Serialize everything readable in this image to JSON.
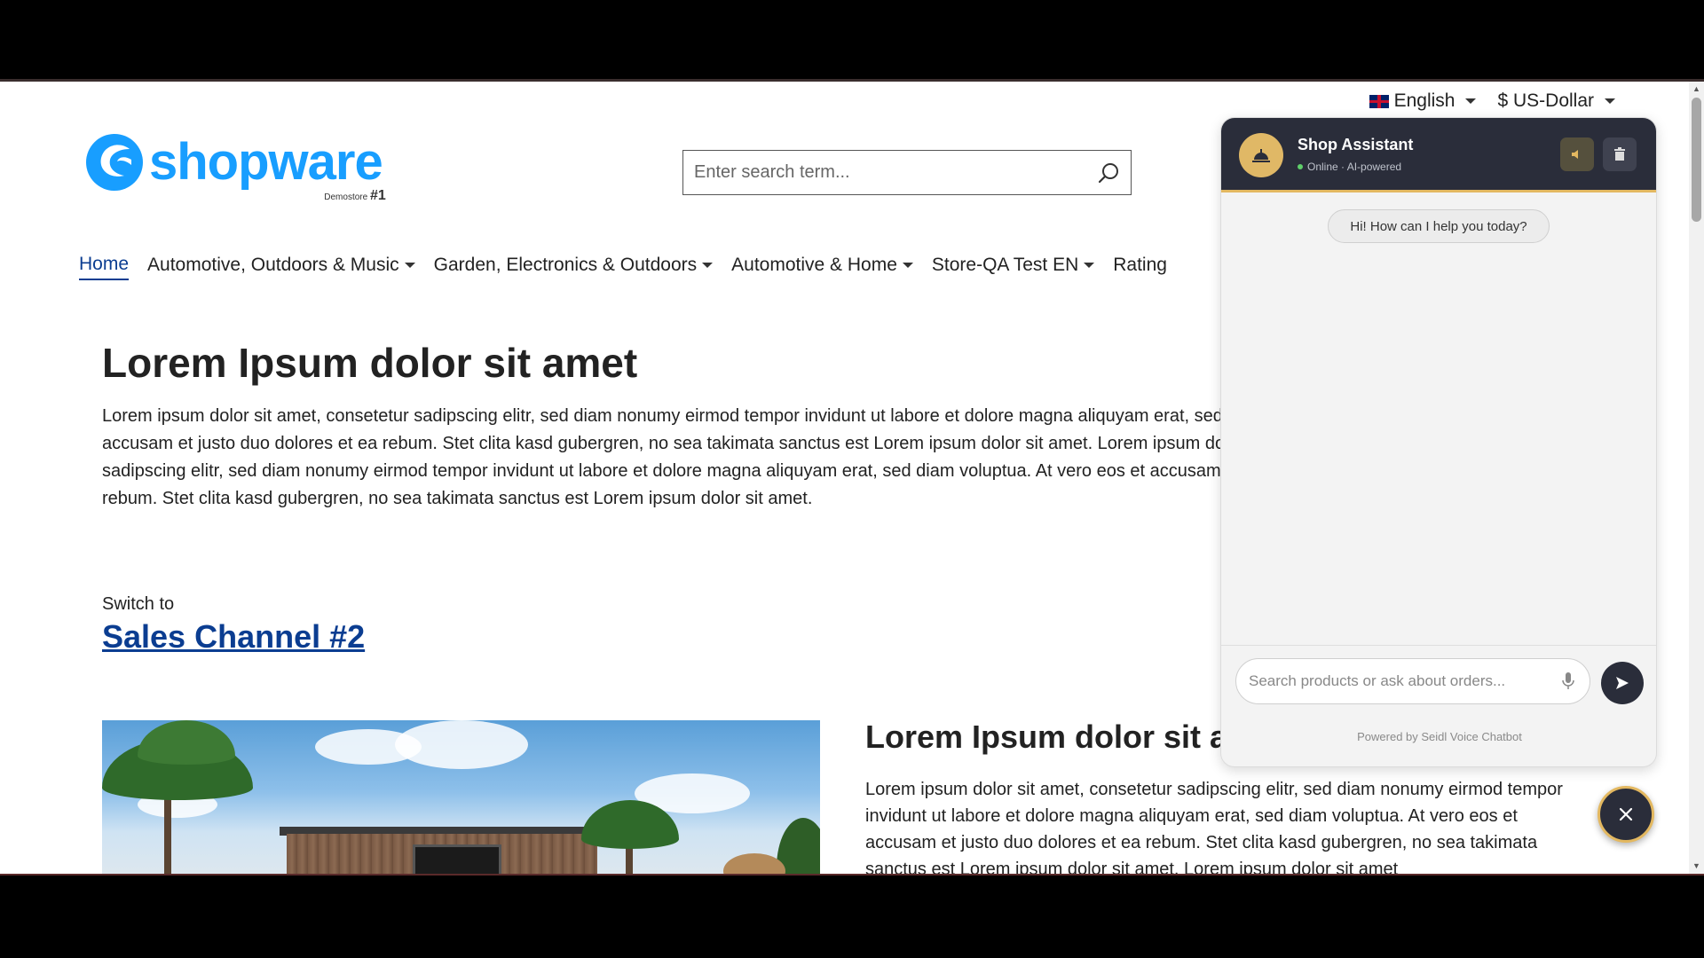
{
  "topbar": {
    "language": "English",
    "currency": "$ US-Dollar"
  },
  "logo": {
    "text": "shopware",
    "sub": "Demostore",
    "sub_number": "#1"
  },
  "search": {
    "placeholder": "Enter search term..."
  },
  "nav": {
    "items": [
      {
        "label": "Home",
        "active": true
      },
      {
        "label": "Automotive, Outdoors & Music"
      },
      {
        "label": "Garden, Electronics & Outdoors"
      },
      {
        "label": "Automotive & Home"
      },
      {
        "label": "Store-QA Test EN"
      },
      {
        "label": "Rating"
      }
    ]
  },
  "content": {
    "title": "Lorem Ipsum dolor sit amet",
    "paragraph_lines": [
      "Lorem ipsum dolor sit amet, consetetur sadipscing elitr, sed diam nonumy eirmod tempor invidunt ut labore et dolore magna aliquyam erat, sed diam voluptua. At vero eos et",
      "accusam et justo duo dolores et ea rebum. Stet clita kasd gubergren, no sea takimata sanctus est Lorem ipsum dolor sit amet. Lorem ipsum dolor sit amet, consetetur",
      "sadipscing elitr, sed diam nonumy eirmod tempor invidunt ut labore et dolore magna aliquyam erat, sed diam voluptua. At vero eos et accusam et justo duo dolores et ea",
      "rebum. Stet clita kasd gubergren, no sea takimata sanctus est Lorem ipsum dolor sit amet."
    ],
    "switch_label": "Switch to",
    "switch_link": "Sales Channel #2",
    "section2_title": "Lorem Ipsum dolor sit amet",
    "section2_text": "Lorem ipsum dolor sit amet, consetetur sadipscing elitr, sed diam nonumy eirmod tempor invidunt ut labore et dolore magna aliquyam erat, sed diam voluptua. At vero eos et accusam et justo duo dolores et ea rebum. Stet clita kasd gubergren, no sea takimata sanctus est Lorem ipsum dolor sit amet. Lorem ipsum dolor sit amet"
  },
  "chat": {
    "title": "Shop Assistant",
    "status": "Online · AI-powered",
    "greeting": "Hi! How can I help you today?",
    "input_placeholder": "Search products or ask about orders...",
    "powered_by": "Powered by Seidl Voice Chatbot",
    "icons": {
      "avatar": "bell-service-icon",
      "speaker": "speaker-icon",
      "trash": "trash-icon",
      "mic": "microphone-icon",
      "send": "send-icon",
      "close": "close-icon"
    },
    "accent": "#e3b860",
    "header_bg": "#2a2d3a"
  }
}
